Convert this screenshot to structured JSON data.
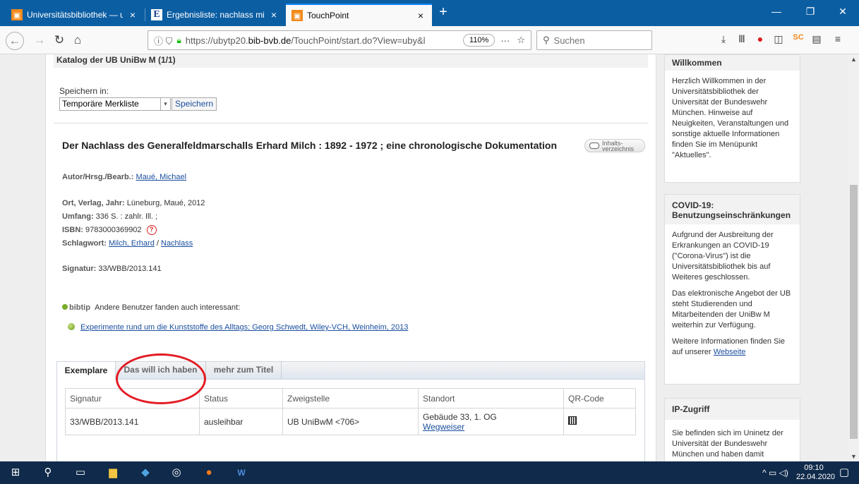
{
  "browser": {
    "tabs": [
      {
        "title": "Universitätsbibliothek — ub",
        "close": "×"
      },
      {
        "title": "Ergebnisliste: nachlass milch: C",
        "close": "×"
      },
      {
        "title": "TouchPoint",
        "close": "×"
      }
    ],
    "new_tab": "+",
    "window": {
      "minimize": "—",
      "restore": "❐",
      "close": "✕"
    },
    "url_prefix": "https://ubytp20.",
    "url_domain": "bib-bvb.de",
    "url_suffix": "/TouchPoint/start.do?View=uby&l",
    "zoom": "110%",
    "page_actions": "···",
    "search_placeholder": "Suchen"
  },
  "catalog_header": "Katalog der UB UniBw M (1/1)",
  "save": {
    "label": "Speichern in:",
    "selected": "Temporäre Merkliste",
    "button": "Speichern"
  },
  "record": {
    "title": "Der Nachlass des Generalfeldmarschalls Erhard Milch : 1892 - 1972 ; eine chronologische Dokumentation",
    "toc_line1": "Inhalts-",
    "toc_line2": "verzeichnis",
    "author_label": "Autor/Hrsg./Bearb.:",
    "author": "Maué, Michael",
    "pub_label": "Ort, Verlag, Jahr:",
    "pub": "Lüneburg, Maué, 2012",
    "extent_label": "Umfang:",
    "extent": "336 S. : zahlr. Ill. ;",
    "isbn_label": "ISBN:",
    "isbn": "9783000369902",
    "subject_label": "Schlagwort:",
    "subject1": "Milch, Erhard",
    "subject_sep": "/",
    "subject2": "Nachlass",
    "signature_label": "Signatur:",
    "signature": "33/WBB/2013.141"
  },
  "bibtip": {
    "logo": "bibtip",
    "text": "Andere Benutzer fanden auch interessant:",
    "recommendation": "Experimente rund um die Kunststoffe des Alltags; Georg Schwedt, Wiley-VCH, Weinheim, 2013"
  },
  "panel_tabs": [
    "Exemplare",
    "Das will ich haben",
    "mehr zum Titel"
  ],
  "holdings": {
    "headers": [
      "Signatur",
      "Status",
      "Zweigstelle",
      "Standort",
      "QR-Code"
    ],
    "rows": [
      {
        "signatur": "33/WBB/2013.141",
        "status": "ausleihbar",
        "zweigstelle": "UB UniBwM <706>",
        "standort": "Gebäude 33, 1. OG",
        "standort_link": "Wegweiser"
      }
    ]
  },
  "sidebar": {
    "welcome_title": "Willkommen",
    "welcome_text": "Herzlich Willkommen in der Universitätsbibliothek der Universität der Bundeswehr München. Hinweise auf Neuigkeiten, Veranstaltungen und sonstige aktuelle Informationen finden Sie im Menüpunkt \"Aktuelles\".",
    "covid_title": "COVID-19: Benutzungseinschränkungen",
    "covid_p1": "Aufgrund der Ausbreitung der Erkrankungen an COVID-19 (\"Corona-Virus\") ist die Universitätsbibliothek bis auf Weiteres geschlossen.",
    "covid_p2": "Das elektronische Angebot der UB steht Studierenden und Mitarbeitenden der UniBw M weiterhin zur Verfügung.",
    "covid_p3": "Weitere Informationen finden Sie auf unserer",
    "covid_link": "Webseite",
    "ip_title": "IP-Zugriff",
    "ip_text": "Sie befinden sich im Uninetz der Universität der Bundeswehr München und haben damit"
  },
  "taskbar": {
    "time": "09:10",
    "date": "22.04.2020"
  },
  "colors": {
    "accent_red": "#e01818",
    "link_blue": "#1a4e9e",
    "tab_blue": "#0c5ea3",
    "taskbar": "#0f2a4a"
  }
}
